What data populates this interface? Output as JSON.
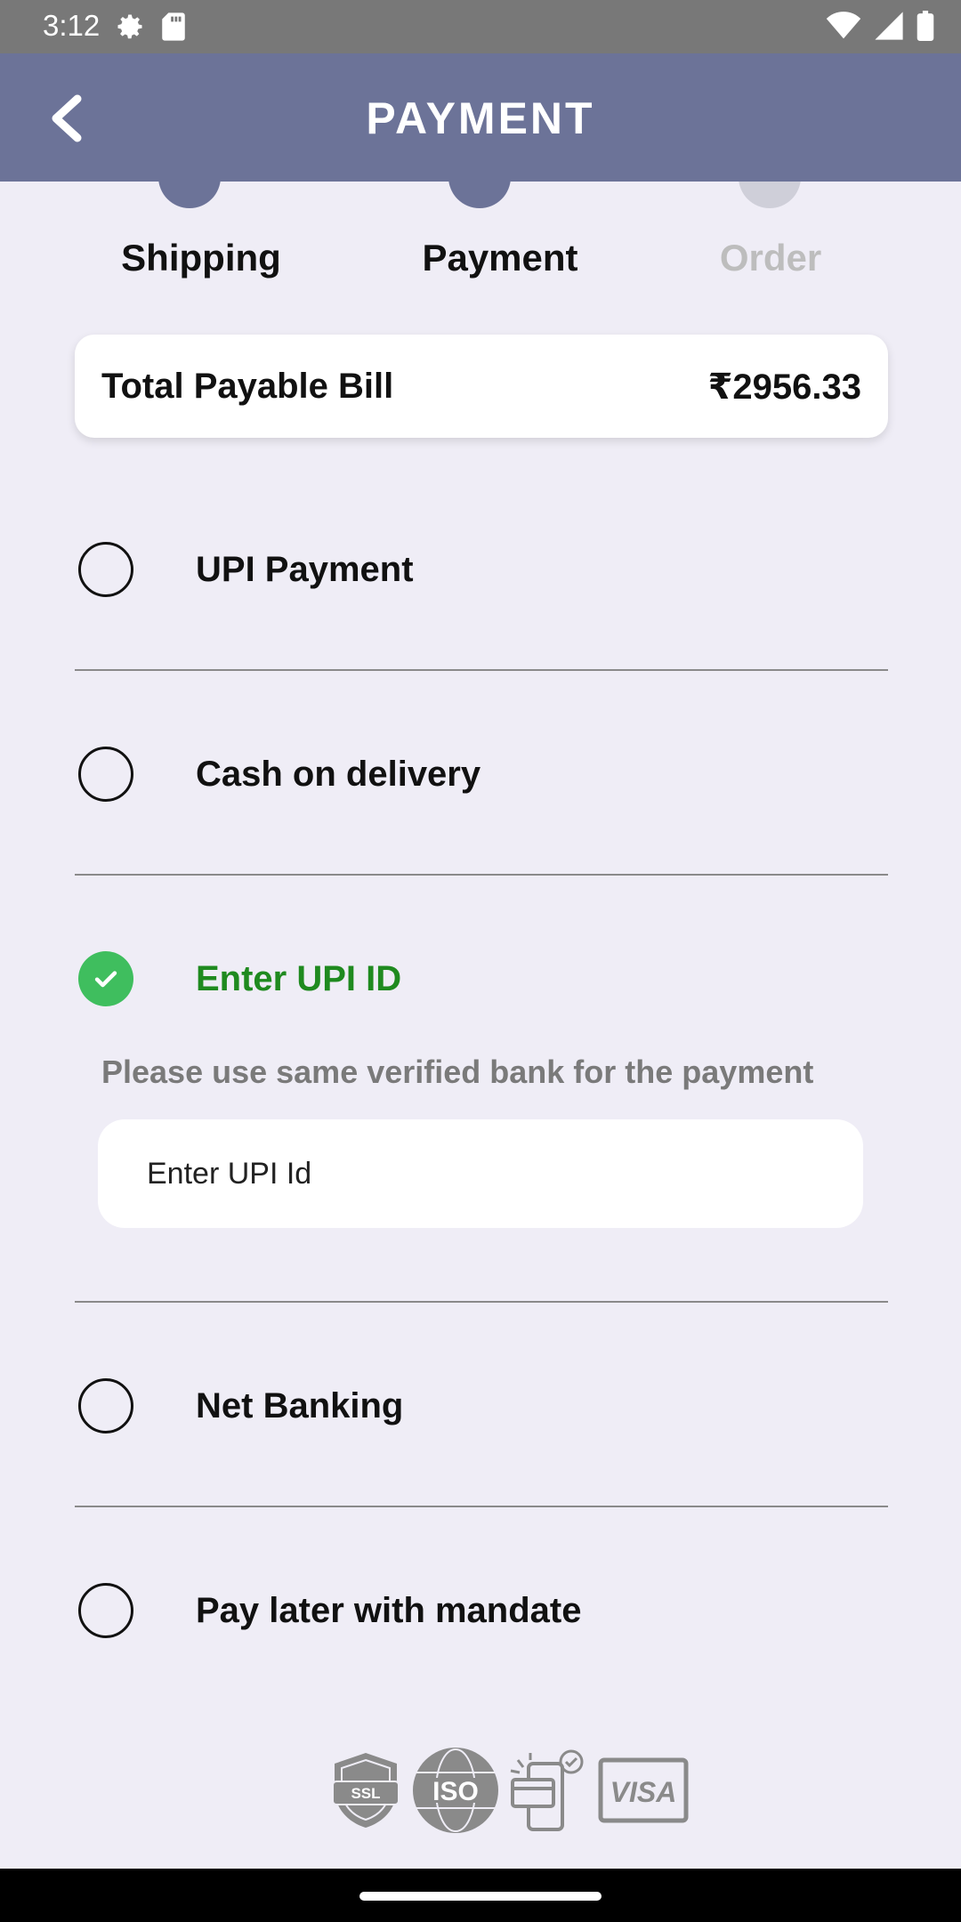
{
  "status_bar": {
    "time": "3:12",
    "left_icons": [
      "settings-icon",
      "sd-card-icon"
    ],
    "right_icons": [
      "wifi-icon",
      "signal-icon",
      "battery-icon"
    ]
  },
  "app_bar": {
    "title": "PAYMENT",
    "back_icon": "chevron-left-icon",
    "color": "#6c7398"
  },
  "steps": [
    {
      "label": "Shipping",
      "state": "done",
      "color": "#111111"
    },
    {
      "label": "Payment",
      "state": "current",
      "color": "#111111"
    },
    {
      "label": "Order",
      "state": "upcoming",
      "color": "#bdbdbd"
    }
  ],
  "total": {
    "label": "Total Payable Bill",
    "amount": "₹2956.33"
  },
  "payment_options": [
    {
      "label": "UPI Payment",
      "selected": false
    },
    {
      "label": "Cash on delivery",
      "selected": false
    },
    {
      "label": "Enter UPI ID",
      "selected": true,
      "accent": "#1f8a1f"
    },
    {
      "label": "Net Banking",
      "selected": false
    },
    {
      "label": "Pay later with mandate",
      "selected": false
    }
  ],
  "upi": {
    "hint": "Please use same verified bank for the payment",
    "placeholder": "Enter UPI Id",
    "value": ""
  },
  "trust_badges": {
    "ssl": "SSL",
    "iso": "ISO",
    "secure_payment_icon": "mobile-card-check-icon",
    "visa": "VISA"
  }
}
